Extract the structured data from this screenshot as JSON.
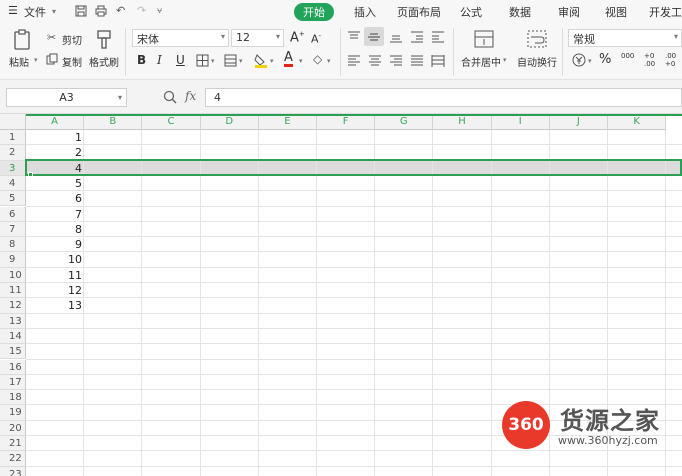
{
  "menubar": {
    "file_label": "文件",
    "tabs": [
      {
        "label": "开始",
        "active": true
      },
      {
        "label": "插入",
        "active": false
      },
      {
        "label": "页面布局",
        "active": false
      },
      {
        "label": "公式",
        "active": false
      },
      {
        "label": "数据",
        "active": false
      },
      {
        "label": "审阅",
        "active": false
      },
      {
        "label": "视图",
        "active": false
      },
      {
        "label": "开发工具",
        "active": false
      }
    ]
  },
  "ribbon": {
    "paste": "粘贴",
    "cut": "剪切",
    "copy": "复制",
    "format_painter": "格式刷",
    "font_name": "宋体",
    "font_size": "12",
    "merge_center": "合并居中",
    "wrap_text": "自动换行",
    "number_format": "常规",
    "percent": "%",
    "thousands": "000",
    "inc_decimal": "+0 .00",
    "dec_decimal": ".00 +0"
  },
  "formula_bar": {
    "name_box": "A3",
    "fx": "fx",
    "value": "4"
  },
  "sheet": {
    "columns": [
      "A",
      "B",
      "C",
      "D",
      "E",
      "F",
      "G",
      "H",
      "I",
      "J",
      "K"
    ],
    "rows": [
      "1",
      "2",
      "3",
      "4",
      "5",
      "6",
      "7",
      "8",
      "9",
      "10",
      "11",
      "12",
      "13",
      "14",
      "15",
      "16",
      "17",
      "18",
      "19",
      "20",
      "21",
      "22",
      "23"
    ],
    "col_a_values": [
      "1",
      "2",
      "4",
      "5",
      "6",
      "7",
      "8",
      "9",
      "10",
      "11",
      "12",
      "13"
    ],
    "selected_row": "3",
    "accent": "#2e9e52"
  },
  "watermark": {
    "badge": "360",
    "name": "货源之家",
    "url": "www.360hyzj.com"
  }
}
